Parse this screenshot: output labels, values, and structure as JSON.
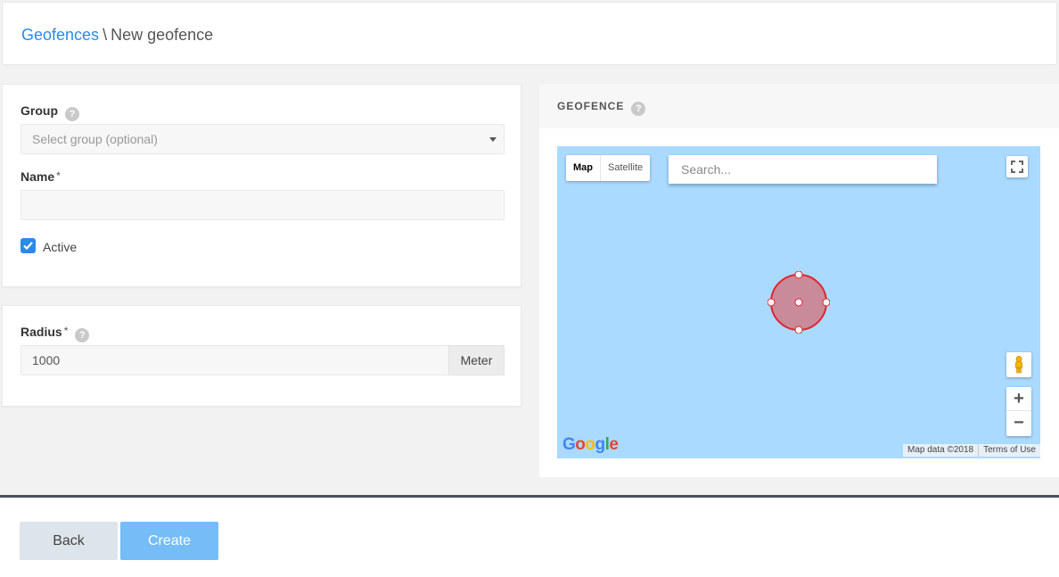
{
  "breadcrumb": {
    "parent": "Geofences",
    "separator": "\\",
    "current": "New geofence"
  },
  "form": {
    "group_label": "Group",
    "group_placeholder": "Select group (optional)",
    "name_label": "Name",
    "name_value": "",
    "required_mark": "*",
    "active_label": "Active",
    "active_checked": true,
    "radius_label": "Radius",
    "radius_value": "1000",
    "radius_unit": "Meter",
    "help_glyph": "?"
  },
  "geofence": {
    "title": "GEOFENCE",
    "map": {
      "type_map": "Map",
      "type_satellite": "Satellite",
      "selected_type": "Map",
      "search_placeholder": "Search...",
      "zoom_in": "+",
      "zoom_out": "−",
      "logo": "Google",
      "map_data": "Map data ©2018",
      "terms": "Terms of Use",
      "water_color": "#aadaff",
      "circle_fill": "#c98a9a",
      "circle_stroke": "#e0242e"
    }
  },
  "footer": {
    "back_label": "Back",
    "create_label": "Create"
  },
  "colors": {
    "accent": "#2a8ae6",
    "create_button": "#74bdf7",
    "footer_border": "#4a5160"
  }
}
